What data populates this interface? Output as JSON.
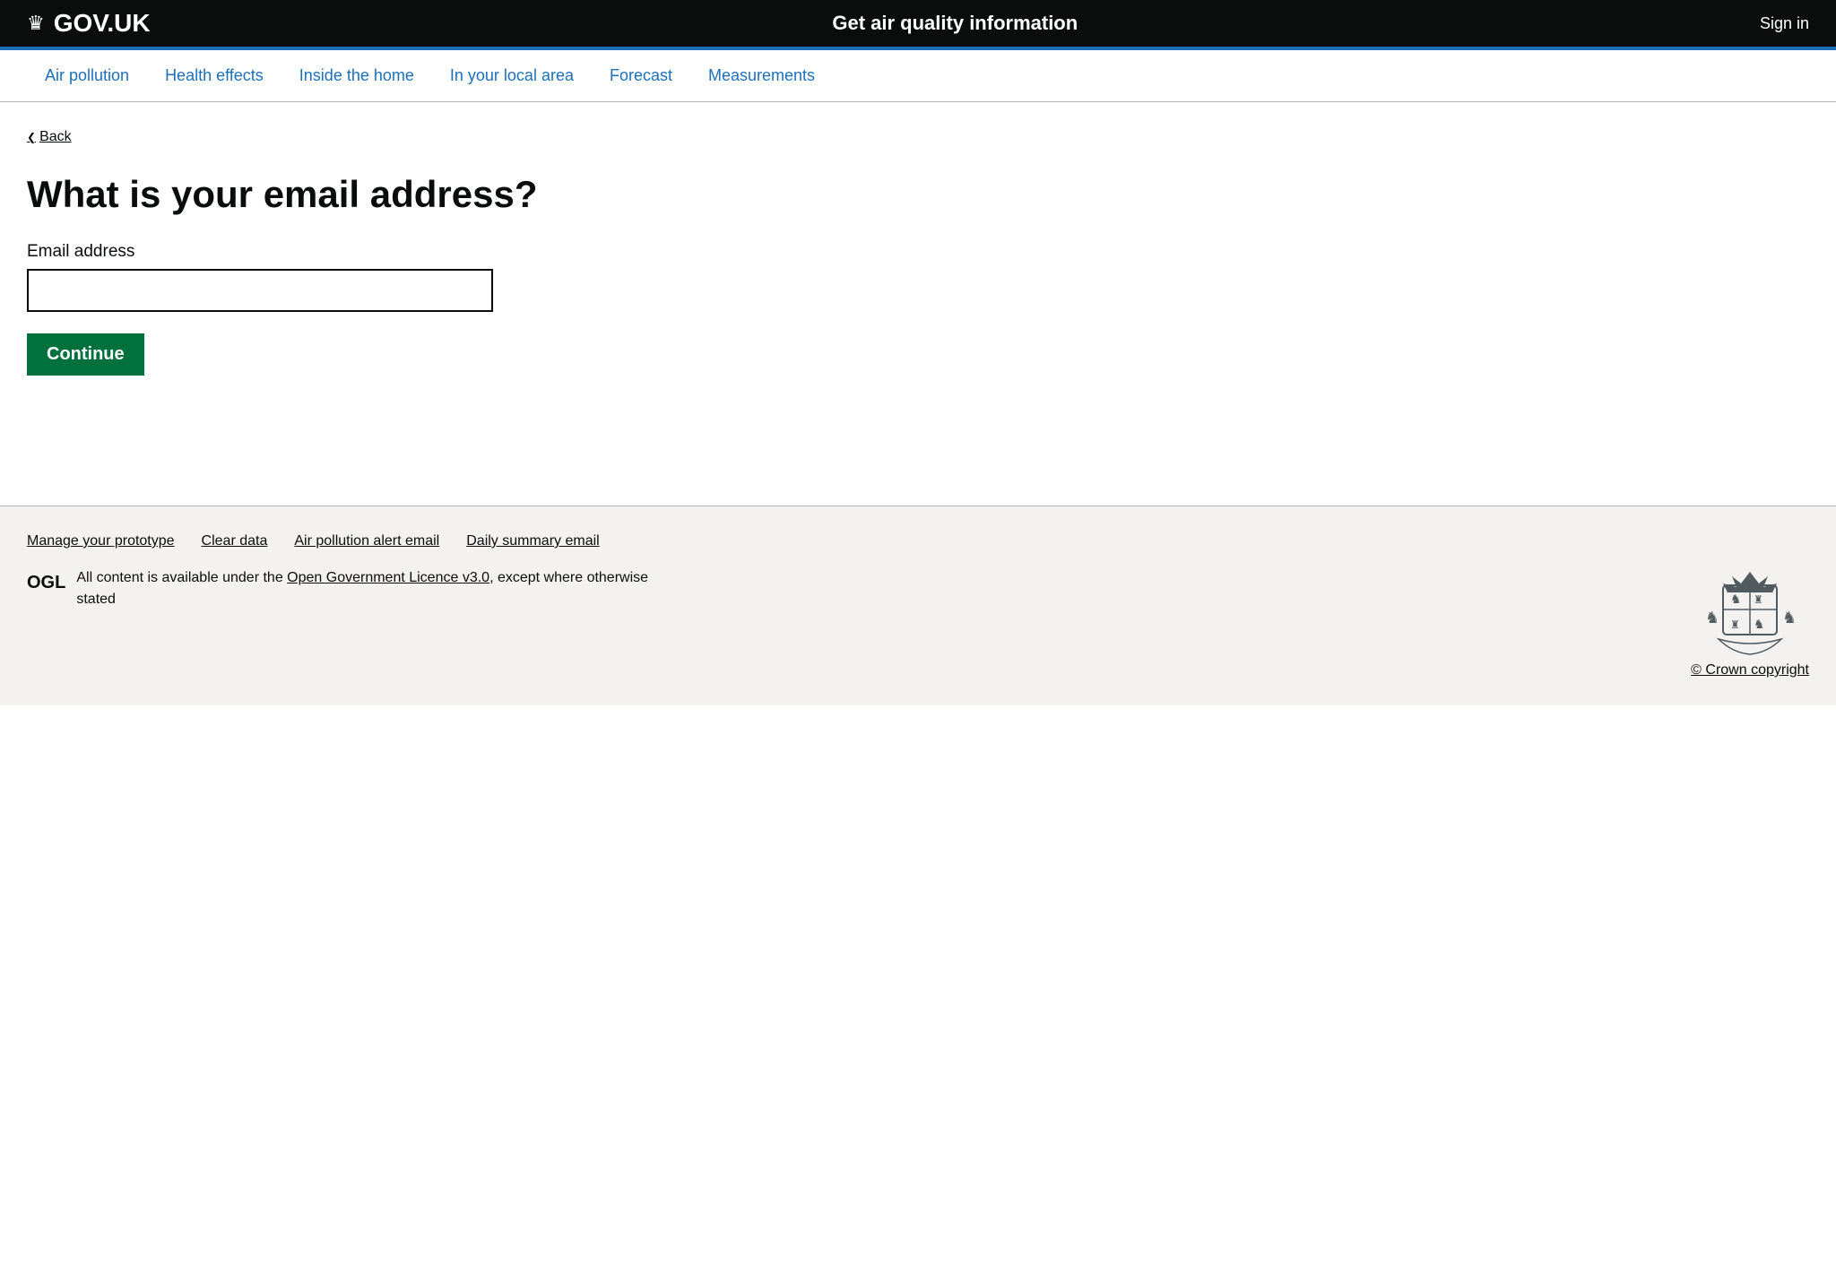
{
  "header": {
    "logo_crown": "♛",
    "logo_text": "GOV.UK",
    "title": "Get air quality information",
    "signin_label": "Sign in"
  },
  "nav": {
    "items": [
      {
        "label": "Air pollution",
        "id": "air-pollution"
      },
      {
        "label": "Health effects",
        "id": "health-effects"
      },
      {
        "label": "Inside the home",
        "id": "inside-home"
      },
      {
        "label": "In your local area",
        "id": "local-area"
      },
      {
        "label": "Forecast",
        "id": "forecast"
      },
      {
        "label": "Measurements",
        "id": "measurements"
      }
    ]
  },
  "back": {
    "label": "Back"
  },
  "form": {
    "heading": "What is your email address?",
    "email_label": "Email address",
    "email_placeholder": "",
    "continue_label": "Continue"
  },
  "footer": {
    "links": [
      {
        "label": "Manage your prototype",
        "id": "manage-prototype"
      },
      {
        "label": "Clear data",
        "id": "clear-data"
      },
      {
        "label": "Air pollution alert email",
        "id": "alert-email"
      },
      {
        "label": "Daily summary email",
        "id": "daily-email"
      }
    ],
    "licence_prefix": "All content is available under the ",
    "licence_link": "Open Government Licence v3.0",
    "licence_suffix": ", except where otherwise stated",
    "ogl_badge": "OGL",
    "crown_copyright": "© Crown copyright"
  }
}
